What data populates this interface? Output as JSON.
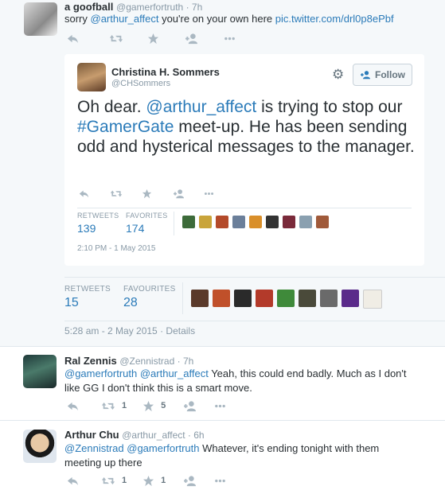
{
  "tweet1": {
    "name": "a goofball",
    "handle": "@gamerfortruth",
    "time": "7h",
    "text_prefix": "sorry ",
    "mention": "@arthur_affect",
    "text_mid": " you're on your own here ",
    "link": "pic.twitter.com/drl0p8ePbf"
  },
  "embed": {
    "name": "Christina H. Sommers",
    "handle": "@CHSommers",
    "follow_label": "Follow",
    "text_1": "Oh dear. ",
    "mention": "@arthur_affect",
    "text_2": " is trying to stop our ",
    "hashtag": "#GamerGate",
    "text_3": " meet-up. He has been sending odd and hysterical messages to the manager.",
    "retweets_label": "RETWEETS",
    "retweets": "139",
    "favorites_label": "FAVORITES",
    "favorites": "174",
    "timestamp": "2:10 PM - 1 May 2015"
  },
  "stats": {
    "retweets_label": "RETWEETS",
    "retweets": "15",
    "favourites_label": "FAVOURITES",
    "favourites": "28",
    "timestamp": "5:28 am - 2 May 2015",
    "sep": " · ",
    "details": "Details"
  },
  "reply1": {
    "name": "Ral Zennis",
    "handle": "@Zennistrad",
    "time": "7h",
    "mention1": "@gamerfortruth",
    "mention2": "@arthur_affect",
    "text": " Yeah, this could end badly. Much as I don't like GG I don't think this is a smart move.",
    "retweet_count": "1",
    "favorite_count": "5"
  },
  "reply2": {
    "name": "Arthur Chu",
    "handle": "@arthur_affect",
    "time": "6h",
    "mention1": "@Zennistrad",
    "mention2": "@gamerfortruth",
    "text": " Whatever, it's ending tonight with them meeting up there",
    "retweet_count": "1",
    "favorite_count": "1"
  },
  "dot": " · ",
  "colors": {
    "link": "#2b7bb9",
    "muted": "#8899a6",
    "icon": "#aab8c2"
  },
  "icons": [
    "reply-icon",
    "retweet-icon",
    "favorite-icon",
    "follow-icon",
    "more-icon",
    "gear-icon"
  ]
}
